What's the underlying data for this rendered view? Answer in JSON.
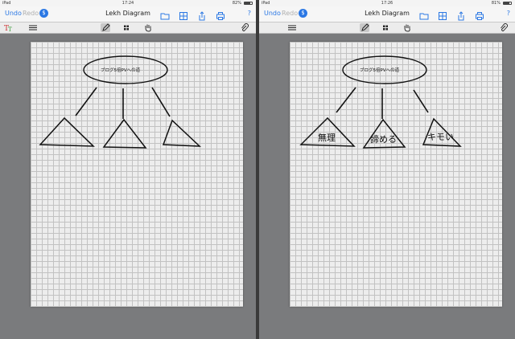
{
  "screens": [
    {
      "status": {
        "device": "iPad",
        "time": "17:24",
        "battery": "82%",
        "battery_level": 0.82
      },
      "nav": {
        "undo": "Undo",
        "redo": "Redo",
        "dollar": "$",
        "title": "Lekh Diagram",
        "help": "?"
      },
      "diagram": {
        "root_text": "ブログ5倍PVへの道",
        "labels": [
          "",
          "",
          ""
        ]
      }
    },
    {
      "status": {
        "device": "iPad",
        "time": "17:26",
        "battery": "81%",
        "battery_level": 0.81
      },
      "nav": {
        "undo": "Undo",
        "redo": "Redo",
        "dollar": "$",
        "title": "Lekh Diagram",
        "help": "?"
      },
      "diagram": {
        "root_text": "ブログ5倍PVへの道",
        "labels": [
          "無理",
          "諦める",
          "キモい"
        ]
      }
    }
  ],
  "colors": {
    "accent": "#2b78e4",
    "canvas": "#ededed",
    "grid": "#c2c2c2",
    "background": "#7a7b7d"
  },
  "icons": [
    "text-style-icon",
    "menu-icon",
    "folder-icon",
    "grid-view-icon",
    "share-icon",
    "print-icon",
    "pen-icon",
    "apps-icon",
    "hand-icon",
    "paperclip-icon"
  ]
}
